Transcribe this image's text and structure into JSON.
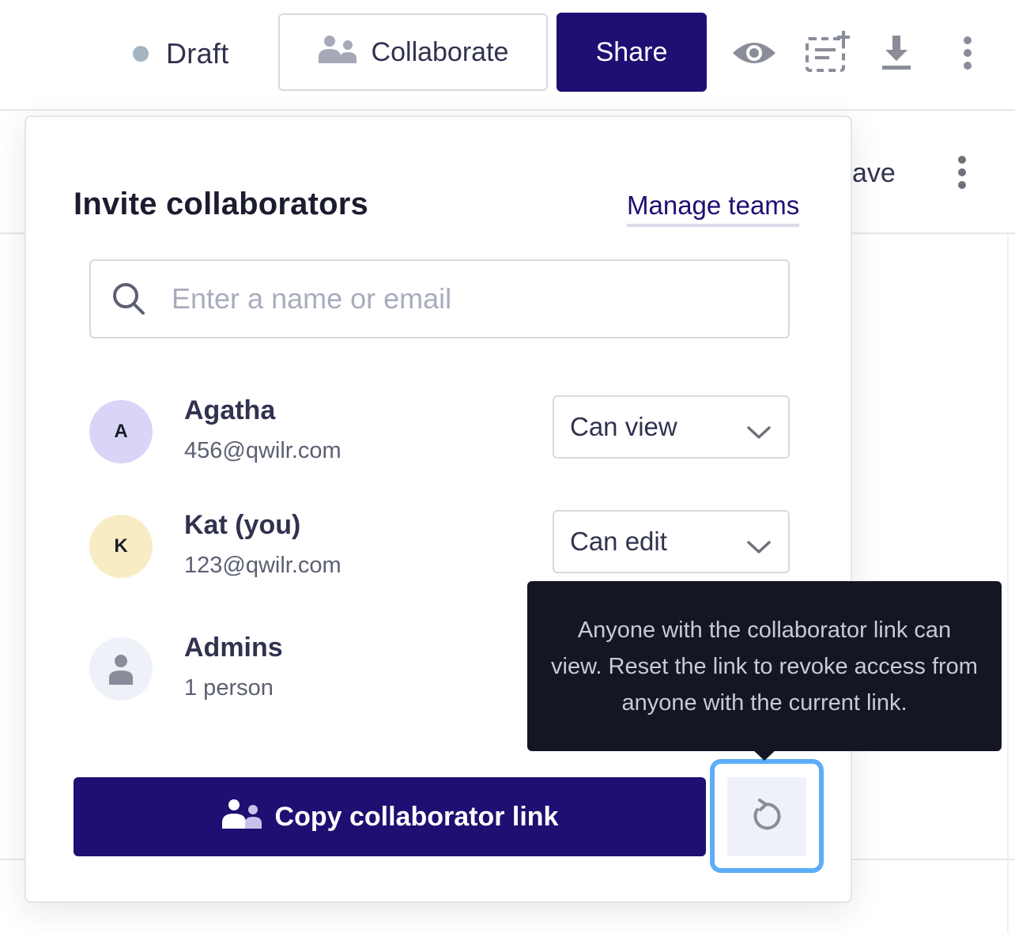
{
  "topbar": {
    "status_label": "Draft",
    "collaborate_label": "Collaborate",
    "share_label": "Share",
    "icons": [
      "status-dot",
      "people-icon",
      "eye-icon",
      "add-block-icon",
      "download-icon",
      "kebab-icon"
    ]
  },
  "background": {
    "save_partial": "ave"
  },
  "panel": {
    "title": "Invite collaborators",
    "manage_teams_label": "Manage teams",
    "search": {
      "placeholder": "Enter a name or email",
      "value": ""
    },
    "people": [
      {
        "initial": "A",
        "name": "Agatha",
        "email": "456@qwilr.com",
        "permission": "Can view",
        "avatar_color": "#d9d5f7"
      },
      {
        "initial": "K",
        "name": "Kat (you)",
        "email": "123@qwilr.com",
        "permission": "Can edit",
        "avatar_color": "#f8ecc4"
      },
      {
        "initial": "",
        "name": "Admins",
        "email": "1 person",
        "permission": "",
        "avatar_color": "#eef1f7"
      }
    ],
    "copy_link_label": "Copy collaborator link",
    "reset_icon": "reset-icon"
  },
  "tooltip": {
    "text": "Anyone with the collaborator link can view. Reset the link to revoke access from anyone with the current link."
  },
  "colors": {
    "primary": "#1e0f72",
    "focus_ring": "#5aaef7",
    "tooltip_bg": "#141624",
    "status_dot": "#a5b4c1"
  }
}
